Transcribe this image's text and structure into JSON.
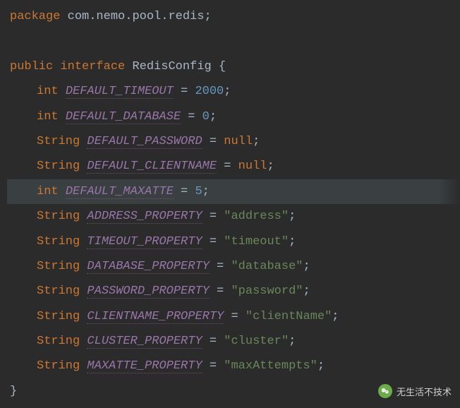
{
  "code": {
    "package_kw": "package",
    "package_name": "com.nemo.pool.redis",
    "public_kw": "public",
    "interface_kw": "interface",
    "class_name": "RedisConfig",
    "open_brace": "{",
    "close_brace": "}",
    "semicolon": ";",
    "eq": " = ",
    "fields": [
      {
        "type": "int",
        "name": "DEFAULT_TIMEOUT",
        "value": "2000",
        "kind": "num"
      },
      {
        "type": "int",
        "name": "DEFAULT_DATABASE",
        "value": "0",
        "kind": "num"
      },
      {
        "type": "String",
        "name": "DEFAULT_PASSWORD",
        "value": "null",
        "kind": "null"
      },
      {
        "type": "String",
        "name": "DEFAULT_CLIENTNAME",
        "value": "null",
        "kind": "null"
      },
      {
        "type": "int",
        "name": "DEFAULT_MAXATTE",
        "value": "5",
        "kind": "num"
      },
      {
        "type": "String",
        "name": "ADDRESS_PROPERTY",
        "value": "\"address\"",
        "kind": "str"
      },
      {
        "type": "String",
        "name": "TIMEOUT_PROPERTY",
        "value": "\"timeout\"",
        "kind": "str"
      },
      {
        "type": "String",
        "name": "DATABASE_PROPERTY",
        "value": "\"database\"",
        "kind": "str"
      },
      {
        "type": "String",
        "name": "PASSWORD_PROPERTY",
        "value": "\"password\"",
        "kind": "str"
      },
      {
        "type": "String",
        "name": "CLIENTNAME_PROPERTY",
        "value": "\"clientName\"",
        "kind": "str"
      },
      {
        "type": "String",
        "name": "CLUSTER_PROPERTY",
        "value": "\"cluster\"",
        "kind": "str"
      },
      {
        "type": "String",
        "name": "MAXATTE_PROPERTY",
        "value": "\"maxAttempts\"",
        "kind": "str"
      }
    ],
    "highlight_line": 7
  },
  "watermark": {
    "text": "无生活不技术",
    "icon": "wechat-icon"
  }
}
